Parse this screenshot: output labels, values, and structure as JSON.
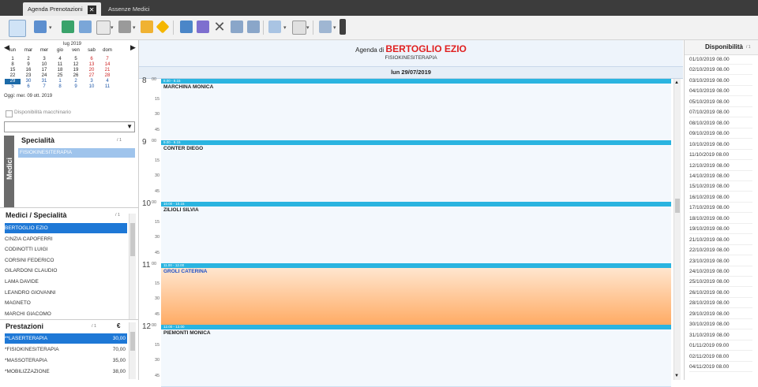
{
  "tabs": [
    {
      "label": "Agenda Prenotazioni",
      "active": true
    },
    {
      "label": "Assenze Medici",
      "active": false
    }
  ],
  "toolbar": {
    "icons": [
      "calendar-icon",
      "new-appointment-icon",
      "copy-icon",
      "columns-icon",
      "preview-icon",
      "print-icon",
      "send-icon",
      "diamond-icon",
      "agenda-list-icon",
      "agenda-edit-icon",
      "delete-icon",
      "grid-icon",
      "list-icon",
      "export-icon",
      "report-icon",
      "forward-icon",
      "bookmark-icon"
    ]
  },
  "calendar": {
    "month_label": "lug 2019",
    "weekdays": [
      "lun",
      "mar",
      "mer",
      "gio",
      "ven",
      "sab",
      "dom"
    ],
    "weeks": [
      [
        "1",
        "2",
        "3",
        "4",
        "5",
        "6",
        "7"
      ],
      [
        "8",
        "9",
        "10",
        "11",
        "12",
        "13",
        "14"
      ],
      [
        "15",
        "16",
        "17",
        "18",
        "19",
        "20",
        "21"
      ],
      [
        "22",
        "23",
        "24",
        "25",
        "26",
        "27",
        "28"
      ],
      [
        "29",
        "30",
        "31",
        "1",
        "2",
        "3",
        "4"
      ],
      [
        "5",
        "6",
        "7",
        "8",
        "9",
        "10",
        "11"
      ]
    ],
    "today_label": "Oggi: mer. 09 ott. 2019"
  },
  "machine": {
    "checkbox_label": "Disponibilità macchinario",
    "dropdown_value": ""
  },
  "specialita": {
    "title": "Specialità",
    "count": "/ 1",
    "items": [
      "FISIOKINESITERAPIA"
    ],
    "side_label": "Medici"
  },
  "medici": {
    "title": "Medici / Specialità",
    "count": "/ 1",
    "items": [
      "BERTOGLIO EZIO",
      "CINZIA CAPOFERRI",
      "CODINOTTI LUIGI",
      "CORSINI FEDERICO",
      "GILARDONI CLAUDIO",
      "LAMA DAVIDE",
      "LEANDRO GIOVANNI",
      "MAGNETO",
      "MARCHI GIACOMO"
    ]
  },
  "prestazioni": {
    "title": "Prestazioni",
    "count": "/ 1",
    "currency": "€",
    "items": [
      {
        "name": "**LASERTERAPIA",
        "price": "30,00"
      },
      {
        "name": "*FISIOKINESITERAPIA",
        "price": "70,00"
      },
      {
        "name": "*MASSOTERAPIA",
        "price": "35,00"
      },
      {
        "name": "*MOBILIZZAZIONE",
        "price": "38,00"
      }
    ]
  },
  "agenda": {
    "title_prefix": "Agenda di",
    "doctor": "BERTOGLIO EZIO",
    "specialty": "FISIOKINESITERAPIA",
    "date": "lun 29/07/2019",
    "hours": [
      {
        "hour": "8",
        "mins": [
          "00",
          "15",
          "30",
          "45"
        ]
      },
      {
        "hour": "9",
        "mins": [
          "00",
          "15",
          "30",
          "45"
        ]
      },
      {
        "hour": "10",
        "mins": [
          "00",
          "15",
          "30",
          "45"
        ]
      },
      {
        "hour": "11",
        "mins": [
          "00",
          "15",
          "30",
          "45"
        ]
      },
      {
        "hour": "12",
        "mins": [
          "00",
          "15",
          "30",
          "45"
        ]
      }
    ],
    "appointments": [
      {
        "time": "8.00 - 8.15",
        "patient": "MARCHINA MONICA"
      },
      {
        "time": "9.00 - 9.15",
        "patient": "CONTER DIEGO"
      },
      {
        "time": "10.00 - 10.15",
        "patient": "ZILIOLI SILVIA"
      },
      {
        "time": "11.00 - 12.00",
        "patient": "GROLI CATERINA"
      },
      {
        "time": "12.00 - 13.00",
        "patient": "PIEMONTI MONICA"
      }
    ]
  },
  "disponibilita": {
    "title": "Disponibilità",
    "count": "/ 1",
    "items": [
      "01/10/2019 08.00",
      "02/10/2019 08.00",
      "03/10/2019 08.00",
      "04/10/2019 08.00",
      "05/10/2019 08.00",
      "07/10/2019 08.00",
      "08/10/2019 08.00",
      "09/10/2019 08.00",
      "10/10/2019 08.00",
      "11/10/2019 08.00",
      "12/10/2019 08.00",
      "14/10/2019 08.00",
      "15/10/2019 08.00",
      "16/10/2019 08.00",
      "17/10/2019 08.00",
      "18/10/2019 08.00",
      "19/10/2019 08.00",
      "21/10/2019 08.00",
      "22/10/2019 08.00",
      "23/10/2019 08.00",
      "24/10/2019 08.00",
      "25/10/2019 08.00",
      "26/10/2019 08.00",
      "28/10/2019 08.00",
      "29/10/2019 08.00",
      "30/10/2019 08.00",
      "31/10/2019 08.00",
      "01/11/2019 09.00",
      "02/11/2019 08.00",
      "04/11/2019 08.00"
    ]
  },
  "colors": {
    "appointment_header": "#2ab4e0",
    "selected": "#1e78d6",
    "doctor_title": "#e02020",
    "highlight_appointment": "#ffab64"
  }
}
